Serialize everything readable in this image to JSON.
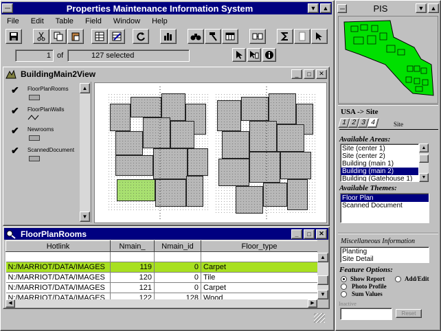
{
  "main_window": {
    "title": "Properties Maintenance Information System",
    "menu": [
      "File",
      "Edit",
      "Table",
      "Field",
      "Window",
      "Help"
    ],
    "record_current": "1",
    "record_of": "of",
    "record_selected": "127 selected"
  },
  "view_window": {
    "title": "BuildingMain2View",
    "legend": [
      {
        "label": "FloorPlanRooms",
        "symbol": "polygon"
      },
      {
        "label": "FloorPlanWalls",
        "symbol": "line"
      },
      {
        "label": "Newrooms",
        "symbol": "polygon"
      },
      {
        "label": "ScannedDocument",
        "symbol": "polygon"
      }
    ]
  },
  "table_window": {
    "title": "FloorPlanRooms",
    "columns": [
      "Hotlink",
      "Nmain_",
      "Nmain_id",
      "Floor_type"
    ],
    "rows": [
      {
        "hotlink": "N:/MARRIOT/DATA/IMAGES",
        "nmain": "119",
        "nmain_id": "0",
        "floor_type": "Carpet",
        "highlight": true
      },
      {
        "hotlink": "N:/MARRIOT/DATA/IMAGES",
        "nmain": "120",
        "nmain_id": "0",
        "floor_type": "Tile",
        "highlight": false
      },
      {
        "hotlink": "N:/MARRIOT/DATA/IMAGES",
        "nmain": "121",
        "nmain_id": "0",
        "floor_type": "Carpet",
        "highlight": false
      },
      {
        "hotlink": "N:/MARRIOT/DATA/IMAGES",
        "nmain": "122",
        "nmain_id": "128",
        "floor_type": "Wood",
        "highlight": false
      }
    ]
  },
  "pis_panel": {
    "title": "PIS",
    "breadcrumb": "USA -> Site",
    "tabs": [
      "1",
      "2",
      "3",
      "4"
    ],
    "tab_label": "Site",
    "available_areas_label": "Available Areas:",
    "areas": [
      "Site (center 1)",
      "Site (center 2)",
      "Building (main 1)",
      "Building (main 2)",
      "Building (Gatehouse 1)"
    ],
    "selected_area": "Building (main 2)",
    "available_themes_label": "Available Themes:",
    "themes": [
      "Floor Plan",
      "Scanned Document"
    ],
    "selected_theme": "Floor Plan",
    "misc_label": "Miscellaneous Information",
    "misc_items": [
      "Planting",
      "Site Detail"
    ],
    "feature_options_label": "Feature Options:",
    "options": {
      "show_report": "Show Report",
      "add_edit": "Add/Edit",
      "photo_profile": "Photo Profile",
      "sum_values": "Sum Values"
    },
    "inactive_label": "Inactive",
    "reset_button": "Reset"
  },
  "colors": {
    "title_bar": "#000080",
    "selection": "#000080",
    "highlight_row": "#a8e020",
    "site_green": "#00e000"
  }
}
